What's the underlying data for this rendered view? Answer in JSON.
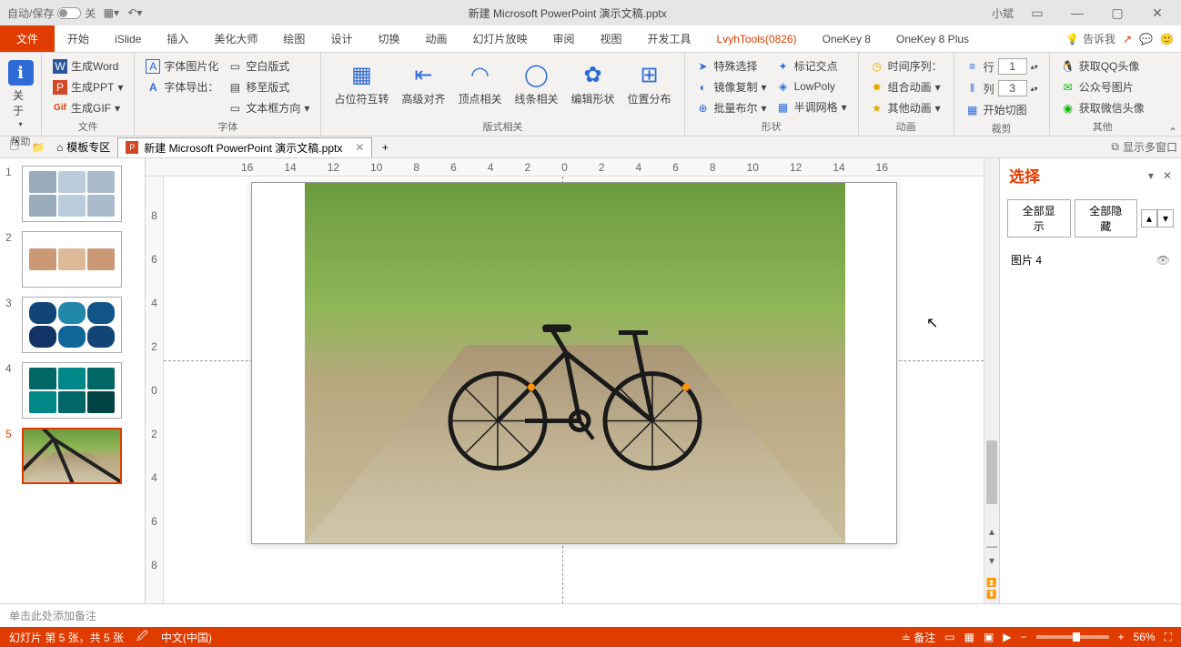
{
  "titlebar": {
    "autosave": "自动/保存",
    "autosave_state": "关",
    "title": "新建 Microsoft PowerPoint 演示文稿.pptx",
    "username": "小斌"
  },
  "tabs": {
    "file": "文件",
    "items": [
      "开始",
      "iSlide",
      "插入",
      "美化大师",
      "绘图",
      "设计",
      "切换",
      "动画",
      "幻灯片放映",
      "审阅",
      "视图",
      "开发工具",
      "LvyhTools(0826)",
      "OneKey 8",
      "OneKey 8 Plus"
    ],
    "active_index": 12,
    "tell_me": "告诉我"
  },
  "ribbon": {
    "help": {
      "about": "关于",
      "title": "帮助"
    },
    "file_group": {
      "gen_word": "生成Word",
      "gen_ppt": "生成PPT",
      "gen_gif": "生成GIF",
      "title": "文件"
    },
    "font_group": {
      "img_text": "字体图片化",
      "to_template": "移至版式",
      "font_export": "字体导出：",
      "textbox_dir": "文本框方向",
      "blank_style": "空白版式",
      "title": "字体"
    },
    "layout_group": {
      "slot": "占位符互转",
      "align": "高级对齐",
      "vertex": "顶点相关",
      "line": "线条相关",
      "edit_shape": "编辑形状",
      "distribute": "位置分布",
      "title": "版式相关"
    },
    "shape_group": {
      "special": "特殊选择",
      "mark": "标记交点",
      "mirror": "镜像复制",
      "lowpoly": "LowPoly",
      "batch": "批量布尔",
      "halftone": "半调网格",
      "title": "形状"
    },
    "anim_group": {
      "time": "时间序列：",
      "combo": "组合动画",
      "other": "其他动画",
      "title": "动画"
    },
    "crop_group": {
      "row": "行",
      "col": "列",
      "row_val": "1",
      "col_val": "3",
      "start": "开始切图",
      "title": "裁剪"
    },
    "other_group": {
      "qq": "获取QQ头像",
      "wechat_img": "公众号图片",
      "wx_avatar": "获取微信头像",
      "title": "其他"
    }
  },
  "tabs_bar": {
    "template_zone": "模板专区",
    "doc_name": "新建 Microsoft PowerPoint 演示文稿.pptx",
    "multi_window": "显示多窗口"
  },
  "thumbs": [
    1,
    2,
    3,
    4,
    5
  ],
  "selection_panel": {
    "title": "选择",
    "show_all": "全部显示",
    "hide_all": "全部隐藏",
    "item": "图片 4"
  },
  "notes_placeholder": "单击此处添加备注",
  "statusbar": {
    "slide_info": "幻灯片 第 5 张，共 5 张",
    "language": "中文(中国)",
    "notes": "备注",
    "zoom": "56%"
  },
  "ruler_h": [
    "16",
    "14",
    "12",
    "10",
    "8",
    "6",
    "4",
    "2",
    "0",
    "2",
    "4",
    "6",
    "8",
    "10",
    "12",
    "14",
    "16"
  ],
  "ruler_v": [
    "8",
    "6",
    "4",
    "2",
    "0",
    "2",
    "4",
    "6",
    "8"
  ]
}
